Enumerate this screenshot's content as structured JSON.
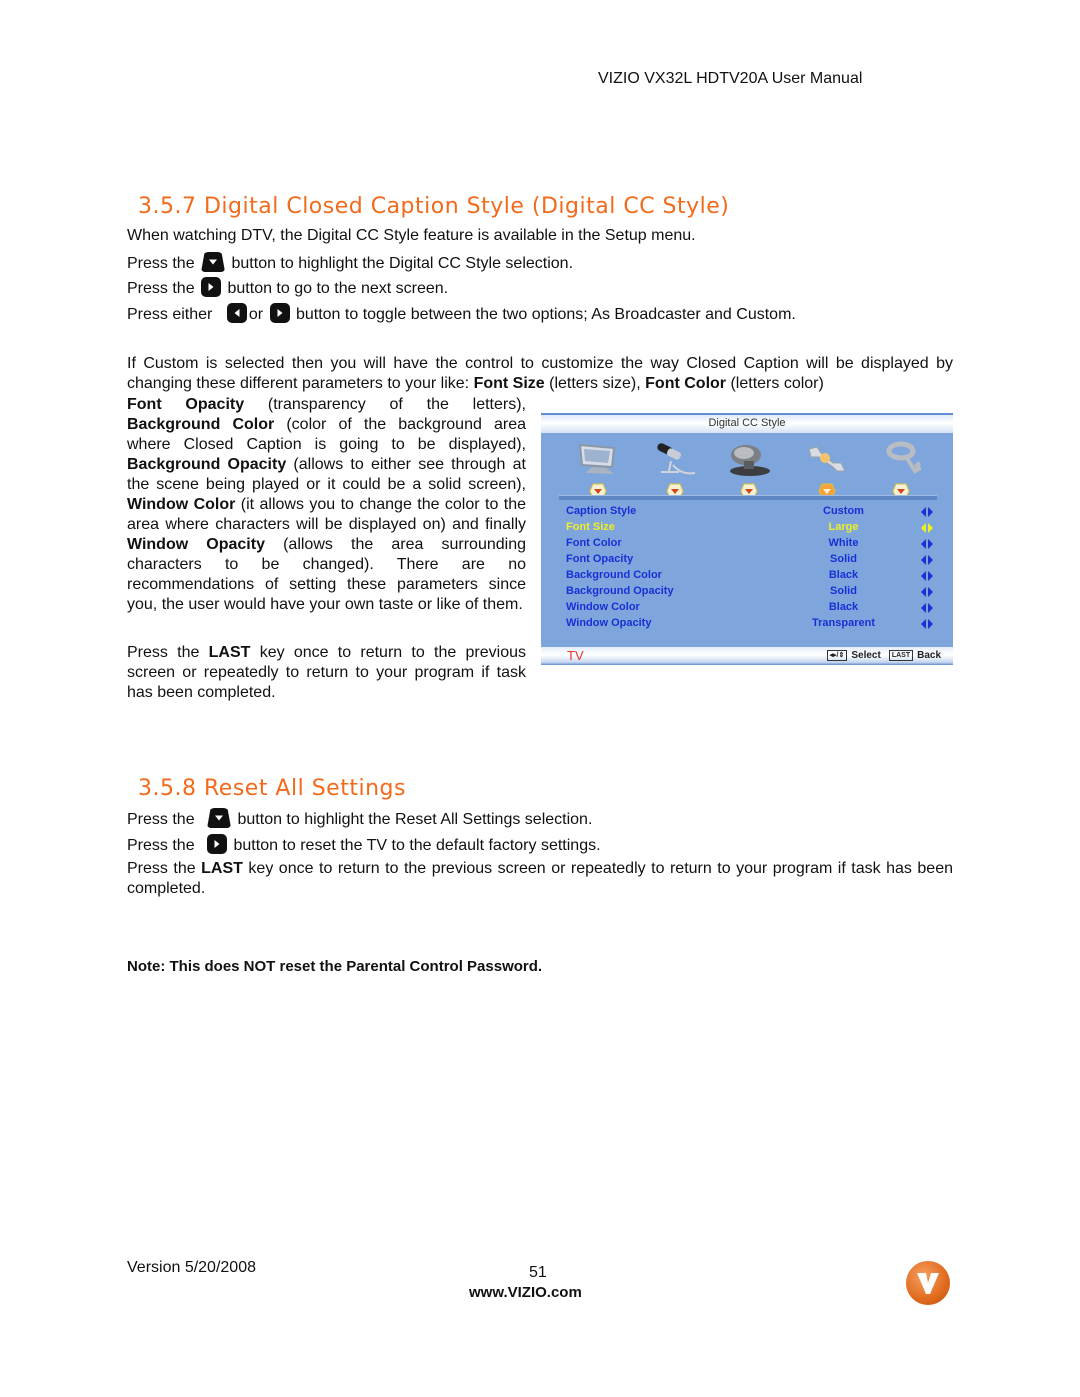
{
  "header": {
    "title": "VIZIO VX32L HDTV20A User Manual"
  },
  "section_357": {
    "number": "3.5.7",
    "title": "Digital Closed Caption Style (Digital CC Style)",
    "intro": "When watching DTV, the Digital CC Style feature is available in the Setup menu.",
    "step1_pre": "Press the",
    "step1_post": "button to highlight the Digital CC Style selection.",
    "step2_pre": "Press the",
    "step2_post": "button to go to the next screen.",
    "step3_pre": "Press either",
    "step3_mid": "or",
    "step3_post": "button to toggle between the two options; As Broadcaster and Custom.",
    "custom_para": {
      "t1": "If Custom is selected then you will have the control to customize the way Closed Caption will be displayed by changing these different parameters to your like: ",
      "b1": "Font Size",
      "t2": " (letters size), ",
      "b2": "Font Color",
      "t3": " (letters color)",
      "b3": "Font Opacity",
      "t4": " (transparency of the letters), ",
      "b4": "Background Color",
      "t5": " (color of the background area where Closed Caption is going to be displayed), ",
      "b5": "Background Opacity",
      "t6": " (allows to either see through at the scene being played or it could be a solid screen), ",
      "b6": "Window Color",
      "t7": " (it allows you to change the color to the area where characters will be displayed on) and finally ",
      "b7": "Window Opacity",
      "t8": " (allows the area surrounding characters to be changed). There are no recommendations of setting these parameters since you, the user would have your own taste or like of them."
    },
    "last_para": {
      "t1": "Press the ",
      "b1": "LAST",
      "t2": " key once to return to the previous screen or repeatedly to return to your program if task has been completed."
    }
  },
  "osd": {
    "title": "Digital CC Style",
    "icons": [
      "tv-picture-icon",
      "microphone-audio-icon",
      "satellite-dish-icon",
      "wrench-setup-icon",
      "key-parental-icon"
    ],
    "selected_icon_index": 3,
    "rows": [
      {
        "label": "Caption Style",
        "value": "Custom",
        "highlighted": false
      },
      {
        "label": "Font Size",
        "value": "Large",
        "highlighted": true
      },
      {
        "label": "Font Color",
        "value": "White",
        "highlighted": false
      },
      {
        "label": "Font Opacity",
        "value": "Solid",
        "highlighted": false
      },
      {
        "label": "Background Color",
        "value": "Black",
        "highlighted": false
      },
      {
        "label": "Background Opacity",
        "value": "Solid",
        "highlighted": false
      },
      {
        "label": "Window Color",
        "value": "Black",
        "highlighted": false
      },
      {
        "label": "Window Opacity",
        "value": "Transparent",
        "highlighted": false
      }
    ],
    "footer_source": "TV",
    "footer_nav_key": "◂▸/⇕",
    "footer_select": "Select",
    "footer_last_key": "LAST",
    "footer_back": "Back",
    "colors": {
      "background": "#7ea6dc",
      "text": "#1a2fd6",
      "highlight": "#f0ef22",
      "source": "#e5352a"
    }
  },
  "section_358": {
    "number": "3.5.8",
    "title": "Reset All Settings",
    "step1_pre": "Press the",
    "step1_post": "button to highlight the Reset All Settings selection.",
    "step2_pre": "Press the",
    "step2_post": "button to reset the TV to the default factory settings.",
    "last_t1": "Press the ",
    "last_b1": "LAST",
    "last_t2": " key once to return to the previous screen or repeatedly to return to your program if task has been completed.",
    "note": "Note: This does NOT reset the Parental Control Password."
  },
  "footer": {
    "version": "Version 5/20/2008",
    "page": "51",
    "url": "www.VIZIO.com"
  },
  "colors": {
    "heading": "#f26a1b"
  }
}
